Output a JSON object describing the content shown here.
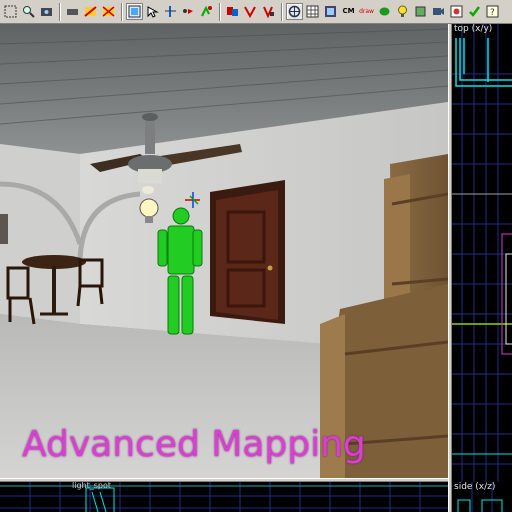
{
  "toolbar": {
    "tools": [
      {
        "name": "selection-tool-icon",
        "glyph": "⬚",
        "active": false
      },
      {
        "name": "magnify-tool-icon",
        "glyph": "⌕",
        "active": false
      },
      {
        "name": "camera-tool-icon",
        "glyph": "▭",
        "active": false
      },
      {
        "name": "entity-tool-icon",
        "glyph": "▬",
        "active": false
      },
      {
        "name": "block-tool-icon",
        "glyph": "▦",
        "active": false
      },
      {
        "name": "texture-tool-icon",
        "glyph": "▩",
        "active": false
      }
    ],
    "cordon_label": "CM",
    "draw_label": "draw"
  },
  "viewport_top": {
    "label": "top (x/y)"
  },
  "viewport_side": {
    "label": "side (x/z)"
  },
  "viewport_front": {
    "label": "light_spot"
  },
  "watermark": {
    "text": "Advanced Mapping"
  },
  "colors": {
    "watermark": "#d93fd0",
    "grid_blue": "#1e2f8a",
    "grid_cyan": "#00e5e5",
    "figure_green": "#22cc22"
  }
}
